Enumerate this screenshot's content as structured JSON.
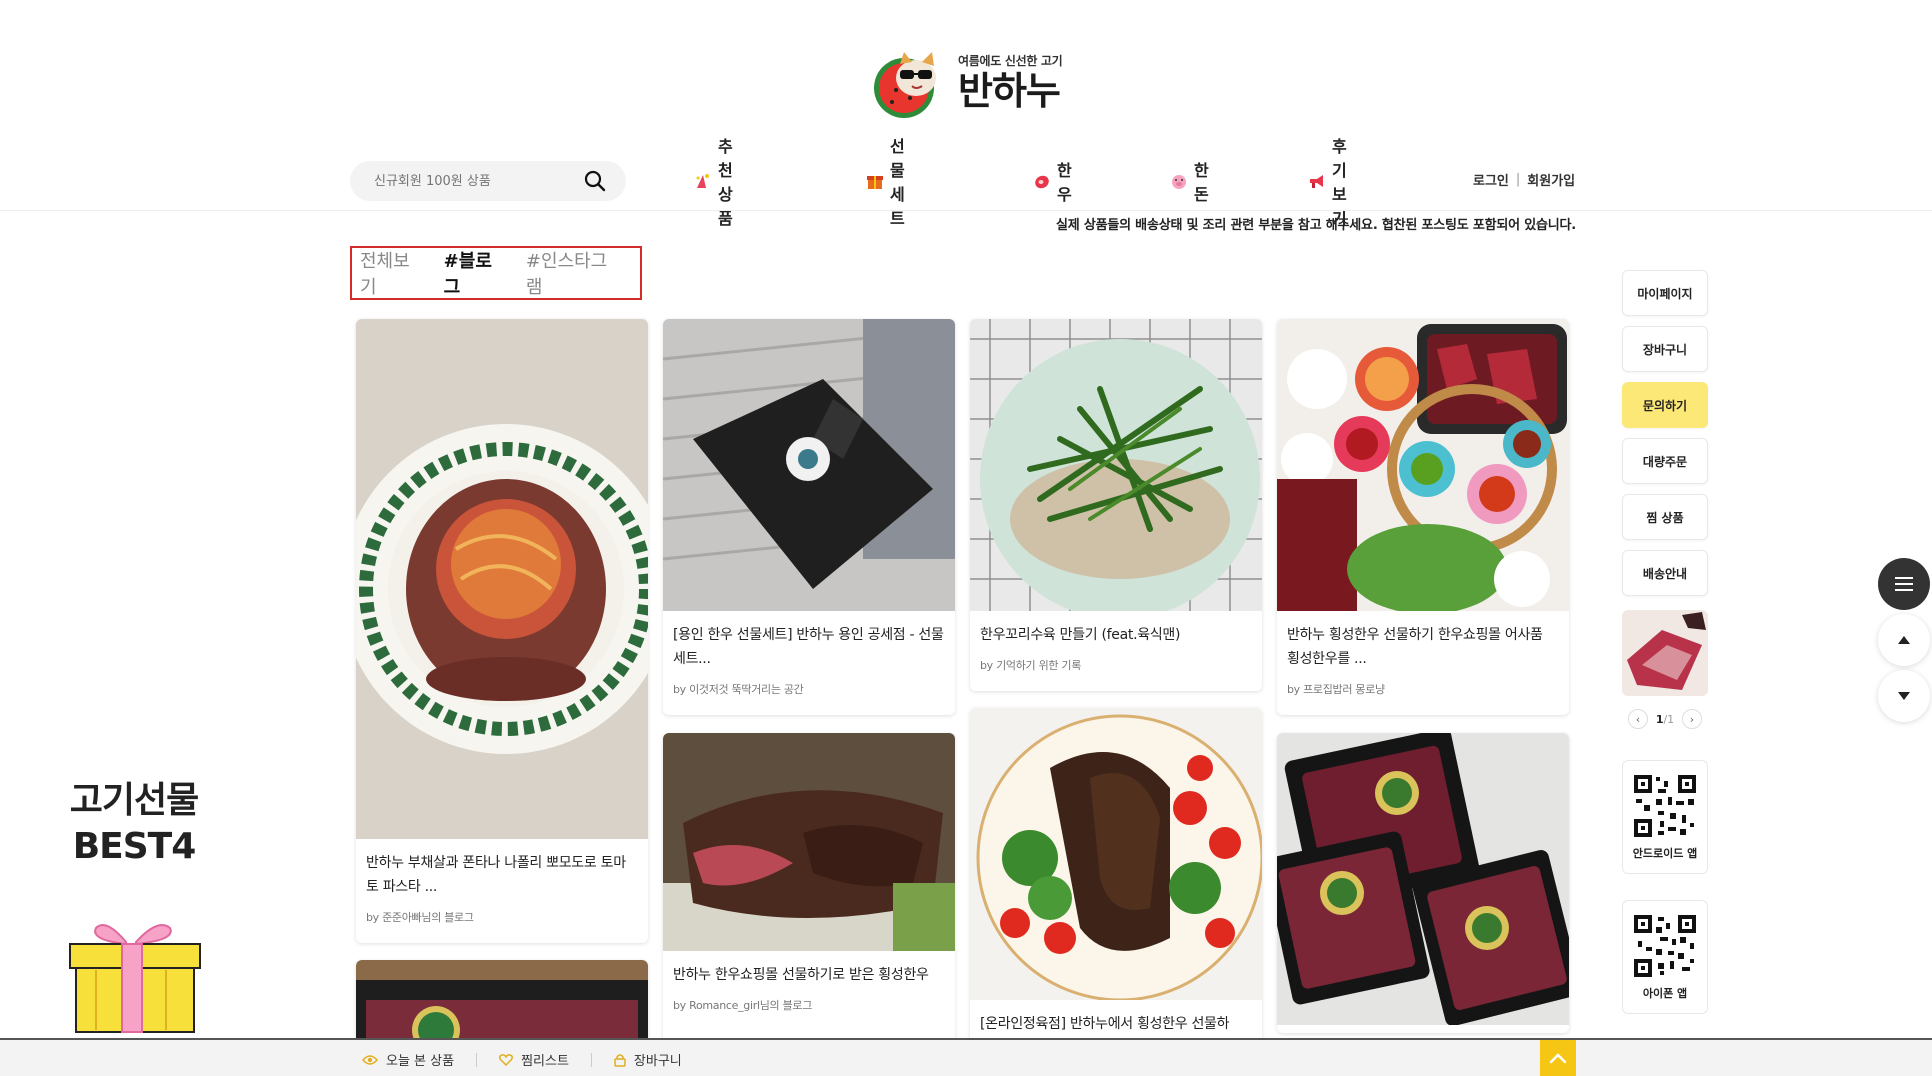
{
  "header": {
    "tagline": "여름에도 신선한 고기",
    "brand": "반하누"
  },
  "search": {
    "placeholder": "신규회원 100원 상품"
  },
  "nav": {
    "items": [
      {
        "label": "추천상품",
        "icon": "sparkle-icon"
      },
      {
        "label": "선물세트",
        "icon": "gift-icon"
      },
      {
        "label": "한우",
        "icon": "meat-icon"
      },
      {
        "label": "한돈",
        "icon": "pig-icon"
      },
      {
        "label": "후기보기",
        "icon": "megaphone-icon"
      }
    ],
    "login": "로그인",
    "signup": "회원가입"
  },
  "notice": "실제 상품들의 배송상태 및 조리 관련 부분을 참고 해주세요. 협찬된 포스팅도 포함되어 있습니다.",
  "filters": {
    "all": "전체보기",
    "blog": "#블로그",
    "instagram": "#인스타그램"
  },
  "posts": [
    {
      "title": "반하누 부채살과 폰타나 나폴리 뽀모도로 토마토 파스타 ...",
      "by": "by 준준아빠님의 블로그"
    },
    {
      "title": "[용인 한우 선물세트] 반하누 용인 공세점 - 선물세트...",
      "by": "by 이것저것 뚝딱거리는 공간"
    },
    {
      "title": "한우꼬리수육 만들기 (feat.육식맨)",
      "by": "by 기억하기 위한 기록"
    },
    {
      "title": "반하누 횡성한우 선물하기 한우쇼핑몰 어사품 횡성한우를 ...",
      "by": "by 프로집밥러 몽로냥"
    },
    {
      "title": "반하누 한우쇼핑몰 선물하기로 받은 횡성한우",
      "by": "by Romance_girl님의 블로그"
    },
    {
      "title": "[온라인정육점] 반하누에서 횡성한우 선물하",
      "by": ""
    }
  ],
  "promo": {
    "line1": "고기선물",
    "line2": "BEST4"
  },
  "quick_menu": {
    "items": [
      "마이페이지",
      "장바구니",
      "문의하기",
      "대량주문",
      "찜 상품",
      "배송안내"
    ],
    "page_current": "1",
    "page_total": "/1",
    "android_label": "안드로이드 앱",
    "iphone_label": "아이폰 앱"
  },
  "bottom_bar": {
    "recent": "오늘 본 상품",
    "wishlist": "찜리스트",
    "cart": "장바구니"
  },
  "colors": {
    "accent_yellow": "#f5c613",
    "highlight": "#fce876",
    "filter_border": "#d42a2a"
  }
}
